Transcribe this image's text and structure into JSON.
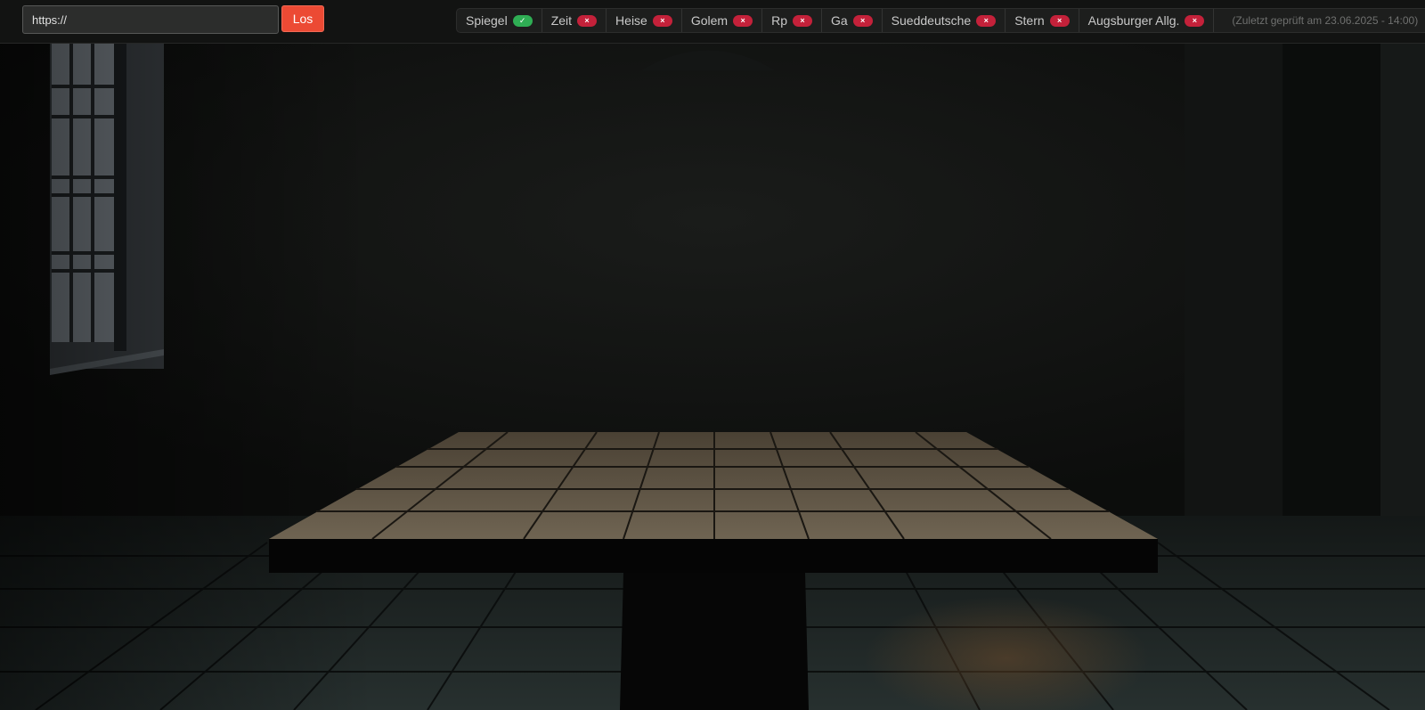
{
  "address_bar": {
    "placeholder": "https://",
    "submit_label": "Los"
  },
  "sources": [
    {
      "name": "Spiegel",
      "status": "ok",
      "status_glyph": "✓"
    },
    {
      "name": "Zeit",
      "status": "fail",
      "status_glyph": "×"
    },
    {
      "name": "Heise",
      "status": "fail",
      "status_glyph": "×"
    },
    {
      "name": "Golem",
      "status": "fail",
      "status_glyph": "×"
    },
    {
      "name": "Rp",
      "status": "fail",
      "status_glyph": "×"
    },
    {
      "name": "Ga",
      "status": "fail",
      "status_glyph": "×"
    },
    {
      "name": "Sueddeutsche",
      "status": "fail",
      "status_glyph": "×"
    },
    {
      "name": "Stern",
      "status": "fail",
      "status_glyph": "×"
    },
    {
      "name": "Augsburger Allg.",
      "status": "fail",
      "status_glyph": "×"
    }
  ],
  "last_checked": "(Zuletzt geprüft am 23.06.2025 - 14:00)",
  "colors": {
    "submit_button": "#ec4a34",
    "status_ok": "#2fae54",
    "status_fail": "#c4213a"
  },
  "icons": {
    "status_ok": "check-icon",
    "status_fail": "close-icon"
  }
}
